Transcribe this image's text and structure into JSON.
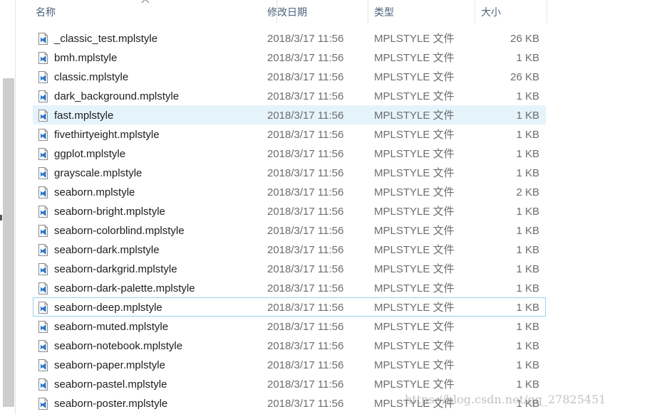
{
  "header": {
    "name_label": "名称",
    "date_label": "修改日期",
    "type_label": "类型",
    "size_label": "大小"
  },
  "files": [
    {
      "name": "_classic_test.mplstyle",
      "date": "2018/3/17 11:56",
      "type": "MPLSTYLE 文件",
      "size": "26 KB"
    },
    {
      "name": "bmh.mplstyle",
      "date": "2018/3/17 11:56",
      "type": "MPLSTYLE 文件",
      "size": "1 KB"
    },
    {
      "name": "classic.mplstyle",
      "date": "2018/3/17 11:56",
      "type": "MPLSTYLE 文件",
      "size": "26 KB"
    },
    {
      "name": "dark_background.mplstyle",
      "date": "2018/3/17 11:56",
      "type": "MPLSTYLE 文件",
      "size": "1 KB"
    },
    {
      "name": "fast.mplstyle",
      "date": "2018/3/17 11:56",
      "type": "MPLSTYLE 文件",
      "size": "1 KB"
    },
    {
      "name": "fivethirtyeight.mplstyle",
      "date": "2018/3/17 11:56",
      "type": "MPLSTYLE 文件",
      "size": "1 KB"
    },
    {
      "name": "ggplot.mplstyle",
      "date": "2018/3/17 11:56",
      "type": "MPLSTYLE 文件",
      "size": "1 KB"
    },
    {
      "name": "grayscale.mplstyle",
      "date": "2018/3/17 11:56",
      "type": "MPLSTYLE 文件",
      "size": "1 KB"
    },
    {
      "name": "seaborn.mplstyle",
      "date": "2018/3/17 11:56",
      "type": "MPLSTYLE 文件",
      "size": "2 KB"
    },
    {
      "name": "seaborn-bright.mplstyle",
      "date": "2018/3/17 11:56",
      "type": "MPLSTYLE 文件",
      "size": "1 KB"
    },
    {
      "name": "seaborn-colorblind.mplstyle",
      "date": "2018/3/17 11:56",
      "type": "MPLSTYLE 文件",
      "size": "1 KB"
    },
    {
      "name": "seaborn-dark.mplstyle",
      "date": "2018/3/17 11:56",
      "type": "MPLSTYLE 文件",
      "size": "1 KB"
    },
    {
      "name": "seaborn-darkgrid.mplstyle",
      "date": "2018/3/17 11:56",
      "type": "MPLSTYLE 文件",
      "size": "1 KB"
    },
    {
      "name": "seaborn-dark-palette.mplstyle",
      "date": "2018/3/17 11:56",
      "type": "MPLSTYLE 文件",
      "size": "1 KB"
    },
    {
      "name": "seaborn-deep.mplstyle",
      "date": "2018/3/17 11:56",
      "type": "MPLSTYLE 文件",
      "size": "1 KB"
    },
    {
      "name": "seaborn-muted.mplstyle",
      "date": "2018/3/17 11:56",
      "type": "MPLSTYLE 文件",
      "size": "1 KB"
    },
    {
      "name": "seaborn-notebook.mplstyle",
      "date": "2018/3/17 11:56",
      "type": "MPLSTYLE 文件",
      "size": "1 KB"
    },
    {
      "name": "seaborn-paper.mplstyle",
      "date": "2018/3/17 11:56",
      "type": "MPLSTYLE 文件",
      "size": "1 KB"
    },
    {
      "name": "seaborn-pastel.mplstyle",
      "date": "2018/3/17 11:56",
      "type": "MPLSTYLE 文件",
      "size": "1 KB"
    },
    {
      "name": "seaborn-poster.mplstyle",
      "date": "2018/3/17 11:56",
      "type": "MPLSTYLE 文件",
      "size": "1 KB"
    }
  ],
  "state": {
    "hover_row": 4,
    "focused_row": 14
  },
  "file_icon": "vscode-file-icon",
  "colors": {
    "header_text": "#4c607a",
    "hover_bg": "#e5f3fb",
    "focus_border": "#99d1ef",
    "icon_blue": "#2b7bd0"
  },
  "watermark": "https://blog.csdn.net/qq_27825451"
}
